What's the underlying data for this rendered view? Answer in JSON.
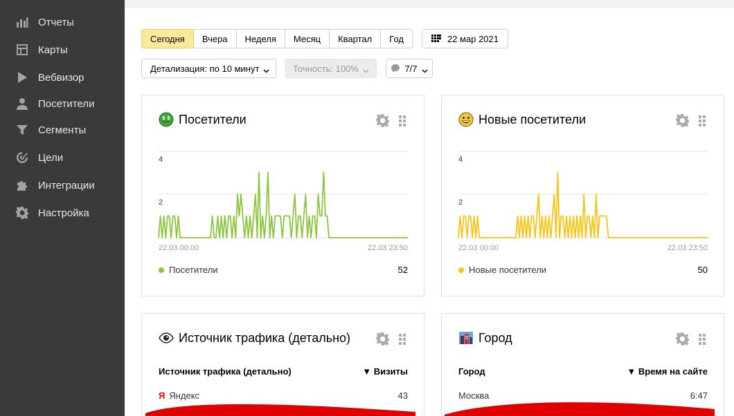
{
  "sidebar": {
    "items": [
      {
        "label": "Отчеты",
        "icon": "bar-chart-icon"
      },
      {
        "label": "Карты",
        "icon": "map-icon"
      },
      {
        "label": "Вебвизор",
        "icon": "play-icon"
      },
      {
        "label": "Посетители",
        "icon": "person-icon"
      },
      {
        "label": "Сегменты",
        "icon": "filter-icon"
      },
      {
        "label": "Цели",
        "icon": "target-icon"
      },
      {
        "label": "Интеграции",
        "icon": "puzzle-icon"
      },
      {
        "label": "Настройка",
        "icon": "gear-icon"
      }
    ]
  },
  "toolbar": {
    "periods": [
      "Сегодня",
      "Вчера",
      "Неделя",
      "Месяц",
      "Квартал",
      "Год"
    ],
    "active_period": "Сегодня",
    "date": "22 мар 2021",
    "detail": "Детализация: по 10 минут",
    "accuracy": "Точность: 100%",
    "segments": "7/7"
  },
  "colors": {
    "green": "#8cc63f",
    "yellow": "#f5c518",
    "active_period_bg": "#fde89b",
    "sidebar_bg": "#3a3a3a"
  },
  "widgets": {
    "visitors": {
      "title": "Посетители",
      "icon": "money-face-emoji-icon",
      "legend_label": "Посетители",
      "total": "52",
      "x_start": "22.03 00:00",
      "x_end": "22.03 23:50",
      "y_ticks": [
        "4",
        "2"
      ]
    },
    "new_visitors": {
      "title": "Новые посетители",
      "icon": "grinning-face-emoji-icon",
      "legend_label": "Новые посетители",
      "total": "50",
      "x_start": "22.03 00:00",
      "x_end": "22.03 23:50",
      "y_ticks": [
        "4",
        "2"
      ]
    },
    "traffic": {
      "title": "Источник трафика (детально)",
      "icon": "eye-icon",
      "col1": "Источник трафика (детально)",
      "col2": "▼ Визиты",
      "row_label": "Яндекс",
      "row_logo": "Я",
      "row_value": "43"
    },
    "city": {
      "title": "Город",
      "icon": "city-emoji-icon",
      "col1": "Город",
      "col2": "▼ Время на сайте",
      "row_label": "Москва",
      "row_value": "6:47"
    }
  },
  "chart_data": [
    {
      "type": "line",
      "title": "Посетители",
      "x_range": [
        "22.03 00:00",
        "22.03 23:50"
      ],
      "ylim": [
        0,
        4
      ],
      "grid": true,
      "series": [
        {
          "name": "Посетители",
          "color": "#8cc63f",
          "values": [
            0,
            1,
            0,
            1,
            0,
            1,
            1,
            0,
            1,
            1,
            0,
            1,
            0,
            0,
            0,
            0,
            0,
            0,
            0,
            0,
            0,
            0,
            0,
            0,
            0,
            0,
            0,
            0,
            0,
            0,
            1,
            0,
            0,
            1,
            0,
            1,
            0,
            1,
            0,
            1,
            1,
            0,
            1,
            0,
            2,
            1,
            2,
            1,
            0,
            1,
            0,
            1,
            0,
            1,
            2,
            0,
            3,
            0,
            1,
            0,
            1,
            3,
            0,
            1,
            0,
            1,
            1,
            1,
            1,
            0,
            1,
            1,
            1,
            1,
            0,
            1,
            2,
            0,
            1,
            1,
            0,
            1,
            2,
            0,
            1,
            0,
            1,
            1,
            0,
            2,
            1,
            1,
            3,
            1,
            1,
            0,
            0,
            0,
            0,
            0,
            0,
            0,
            0,
            0,
            0,
            0,
            0,
            0,
            0,
            0,
            0,
            0,
            0,
            0,
            0,
            0,
            0,
            0,
            0,
            0,
            0,
            0,
            0,
            0,
            0,
            0,
            0,
            0,
            0,
            0,
            0,
            0,
            0,
            0,
            0,
            0,
            0,
            0,
            0,
            0
          ]
        }
      ]
    },
    {
      "type": "line",
      "title": "Новые посетители",
      "x_range": [
        "22.03 00:00",
        "22.03 23:50"
      ],
      "ylim": [
        0,
        4
      ],
      "grid": true,
      "series": [
        {
          "name": "Новые посетители",
          "color": "#f5c518",
          "values": [
            0,
            1,
            0,
            1,
            1,
            0,
            1,
            1,
            0,
            1,
            0,
            1,
            0,
            0,
            0,
            0,
            0,
            0,
            0,
            0,
            0,
            0,
            0,
            0,
            0,
            0,
            0,
            0,
            0,
            0,
            0,
            0,
            0,
            0,
            1,
            0,
            1,
            0,
            1,
            0,
            1,
            0,
            1,
            1,
            0,
            1,
            2,
            0,
            1,
            0,
            1,
            0,
            1,
            0,
            1,
            2,
            0,
            3,
            0,
            1,
            1,
            0,
            1,
            0,
            1,
            0,
            1,
            0,
            1,
            0,
            1,
            0,
            2,
            0,
            1,
            1,
            0,
            1,
            0,
            2,
            0,
            1,
            1,
            1,
            1,
            1,
            0,
            0,
            0,
            0,
            0,
            0,
            0,
            0,
            0,
            0,
            0,
            0,
            0,
            0,
            0,
            0,
            0,
            0,
            0,
            0,
            0,
            0,
            0,
            0,
            0,
            0,
            0,
            0,
            0,
            0,
            0,
            0,
            0,
            0,
            0,
            0,
            0,
            0,
            0,
            0,
            0,
            0,
            0,
            0,
            0,
            0,
            0,
            0,
            0,
            0,
            0,
            0,
            0,
            0,
            0,
            0,
            0,
            0
          ]
        }
      ]
    }
  ]
}
